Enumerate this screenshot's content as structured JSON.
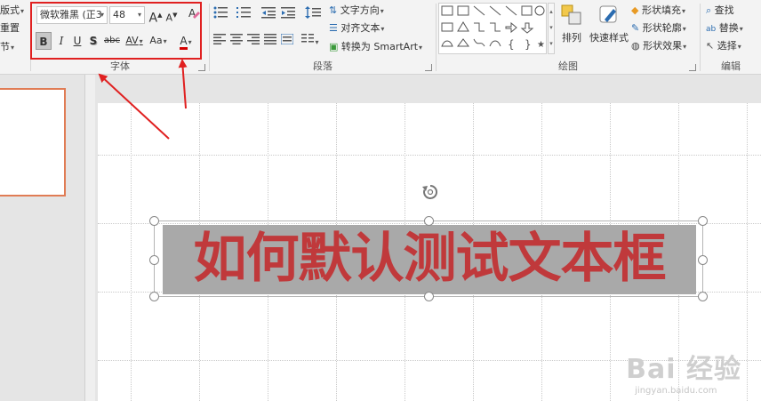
{
  "ribbon": {
    "slides_group": {
      "layout_label": "版式",
      "reset_label": "重置",
      "section_label": "节"
    },
    "font_group": {
      "label": "字体",
      "font_name": "微软雅黑 (正3",
      "font_size": "48",
      "grow_font": "A",
      "shrink_font": "A",
      "bold": "B",
      "italic": "I",
      "underline": "U",
      "shadow": "S",
      "strikethrough": "abc",
      "spacing": "AV",
      "change_case": "Aa",
      "font_color": "A",
      "font_color_hex": "#d40000",
      "highlight_color_hex": "#e03030"
    },
    "paragraph_group": {
      "label": "段落",
      "text_direction": "文字方向",
      "align_text": "对齐文本",
      "convert_smartart": "转换为 SmartArt"
    },
    "drawing_group": {
      "label": "绘图",
      "arrange": "排列",
      "quick_styles": "快速样式",
      "shape_fill": "形状填充",
      "shape_outline": "形状轮廓",
      "shape_effects": "形状效果"
    },
    "editing_group": {
      "label": "编辑",
      "find": "查找",
      "replace": "替换",
      "select": "选择"
    }
  },
  "slide": {
    "title_text": "如何默认测试文本框",
    "text_color": "#c0393b",
    "highlight_color": "#a9a9a9"
  },
  "watermark": {
    "logo": "Bai  经验",
    "url": "jingyan.baidu.com"
  },
  "annotation_color": "#e02020"
}
